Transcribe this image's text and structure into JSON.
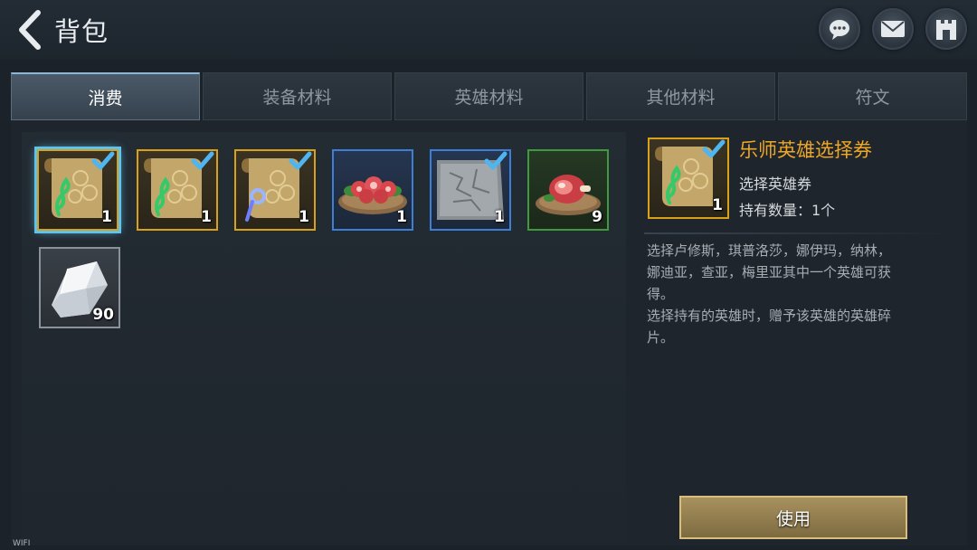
{
  "header": {
    "title": "背包"
  },
  "header_buttons": [
    {
      "name": "chat-button",
      "icon": "chat-bubble-icon"
    },
    {
      "name": "mail-button",
      "icon": "envelope-icon"
    },
    {
      "name": "castle-button",
      "icon": "castle-icon"
    }
  ],
  "tabs": [
    {
      "label": "消费",
      "active": true
    },
    {
      "label": "装备材料",
      "active": false
    },
    {
      "label": "英雄材料",
      "active": false
    },
    {
      "label": "其他材料",
      "active": false
    },
    {
      "label": "符文",
      "active": false
    }
  ],
  "items": [
    {
      "icon": "green-music-scroll-icon",
      "rarity": "gold",
      "count": "1",
      "checked": true,
      "selected": true
    },
    {
      "icon": "green-music-scroll-icon",
      "rarity": "gold",
      "count": "1",
      "checked": true,
      "selected": false
    },
    {
      "icon": "blue-staff-scroll-icon",
      "rarity": "gold",
      "count": "1",
      "checked": true,
      "selected": false
    },
    {
      "icon": "meat-platter-icon",
      "rarity": "blue",
      "count": "1",
      "checked": false,
      "selected": false
    },
    {
      "icon": "stone-slab-icon",
      "rarity": "blue",
      "count": "1",
      "checked": true,
      "selected": false
    },
    {
      "icon": "ham-icon",
      "rarity": "green",
      "count": "9",
      "checked": false,
      "selected": false
    },
    {
      "icon": "crystal-icon",
      "rarity": "grey",
      "count": "90",
      "checked": false,
      "selected": false
    }
  ],
  "detail": {
    "name": "乐师英雄选择券",
    "type": "选择英雄券",
    "quantity": "持有数量：1个",
    "count": "1",
    "description": "选择卢修斯，琪普洛莎，娜伊玛，纳林，\n娜迪亚，查亚，梅里亚其中一个英雄可获\n得。\n选择持有的英雄时，赠予该英雄的英雄碎\n片。"
  },
  "use_button": {
    "label": "使用"
  },
  "status_bar": {
    "network": "WIFI"
  },
  "colors": {
    "accent_gold": "#f0a726",
    "rarity_gold": "#d9a11a",
    "rarity_blue": "#3d7fd6",
    "rarity_green": "#3e9a3c",
    "rarity_grey": "#8b9198",
    "selection_glow": "#5cc4ee"
  }
}
